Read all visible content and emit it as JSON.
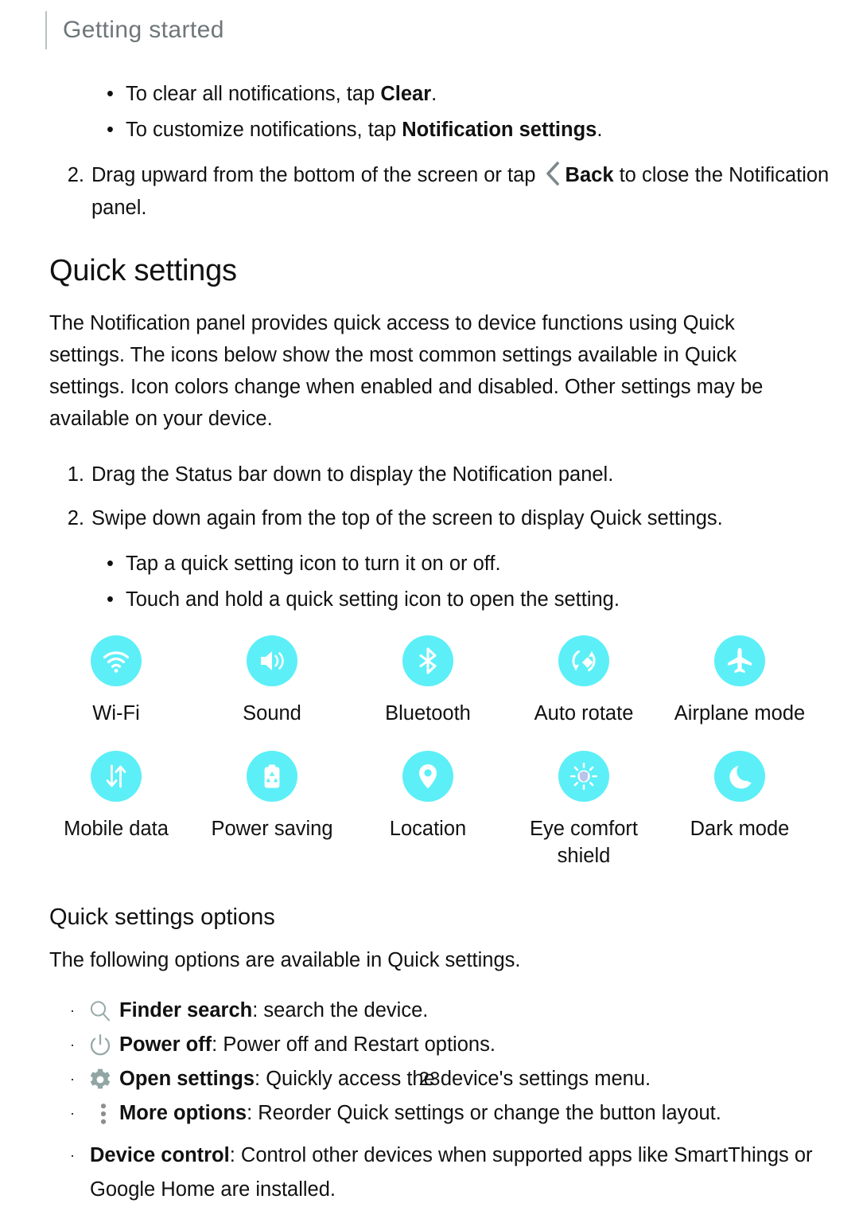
{
  "header": {
    "title": "Getting started"
  },
  "colors": {
    "accent_cyan": "#5CEFF7",
    "icon_gray": "#8FA2A4",
    "header_gray": "#6E7679",
    "text": "#111111"
  },
  "top_list": {
    "bullets": [
      {
        "pre": "To clear all notifications, tap ",
        "bold": "Clear",
        "post": "."
      },
      {
        "pre": "To customize notifications, tap ",
        "bold": "Notification settings",
        "post": "."
      }
    ],
    "step": {
      "number": "2.",
      "pre": "Drag upward from the bottom of the screen or tap ",
      "bold": "Back",
      "post": " to close the Notification panel."
    }
  },
  "quick_settings": {
    "heading": "Quick settings",
    "intro": "The Notification panel provides quick access to device functions using Quick settings. The icons below show the most common settings available in Quick settings. Icon colors change when enabled and disabled. Other settings may be available on your device.",
    "steps": [
      {
        "number": "1.",
        "text": "Drag the Status bar down to display the Notification panel."
      },
      {
        "number": "2.",
        "text": "Swipe down again from the top of the screen to display Quick settings."
      }
    ],
    "bullets": [
      "Tap a quick setting icon to turn it on or off.",
      "Touch and hold a quick setting icon to open the setting."
    ],
    "icons": [
      {
        "label": "Wi-Fi",
        "icon": "wifi-icon"
      },
      {
        "label": "Sound",
        "icon": "sound-icon"
      },
      {
        "label": "Bluetooth",
        "icon": "bluetooth-icon"
      },
      {
        "label": "Auto rotate",
        "icon": "auto-rotate-icon"
      },
      {
        "label": "Airplane mode",
        "icon": "airplane-icon"
      },
      {
        "label": "Mobile data",
        "icon": "mobile-data-icon"
      },
      {
        "label": "Power saving",
        "icon": "power-saving-icon"
      },
      {
        "label": "Location",
        "icon": "location-icon"
      },
      {
        "label": "Eye comfort shield",
        "icon": "eye-comfort-shield-icon"
      },
      {
        "label": "Dark mode",
        "icon": "dark-mode-icon"
      }
    ]
  },
  "options": {
    "heading": "Quick settings options",
    "intro": "The following options are available in Quick settings.",
    "items": [
      {
        "icon": "search-icon",
        "bold": "Finder search",
        "text": ": search the device."
      },
      {
        "icon": "power-off-icon",
        "bold": "Power off",
        "text": ": Power off and Restart options."
      },
      {
        "icon": "gear-icon",
        "bold": "Open settings",
        "text": ": Quickly access the device's settings menu."
      },
      {
        "icon": "more-options-icon",
        "bold": "More options",
        "text": ": Reorder Quick settings or change the button layout."
      },
      {
        "icon": "none",
        "bold": "Device control",
        "text": ": Control other devices when supported apps like SmartThings or Google Home are installed."
      }
    ]
  },
  "footer": {
    "page_number": "23"
  }
}
